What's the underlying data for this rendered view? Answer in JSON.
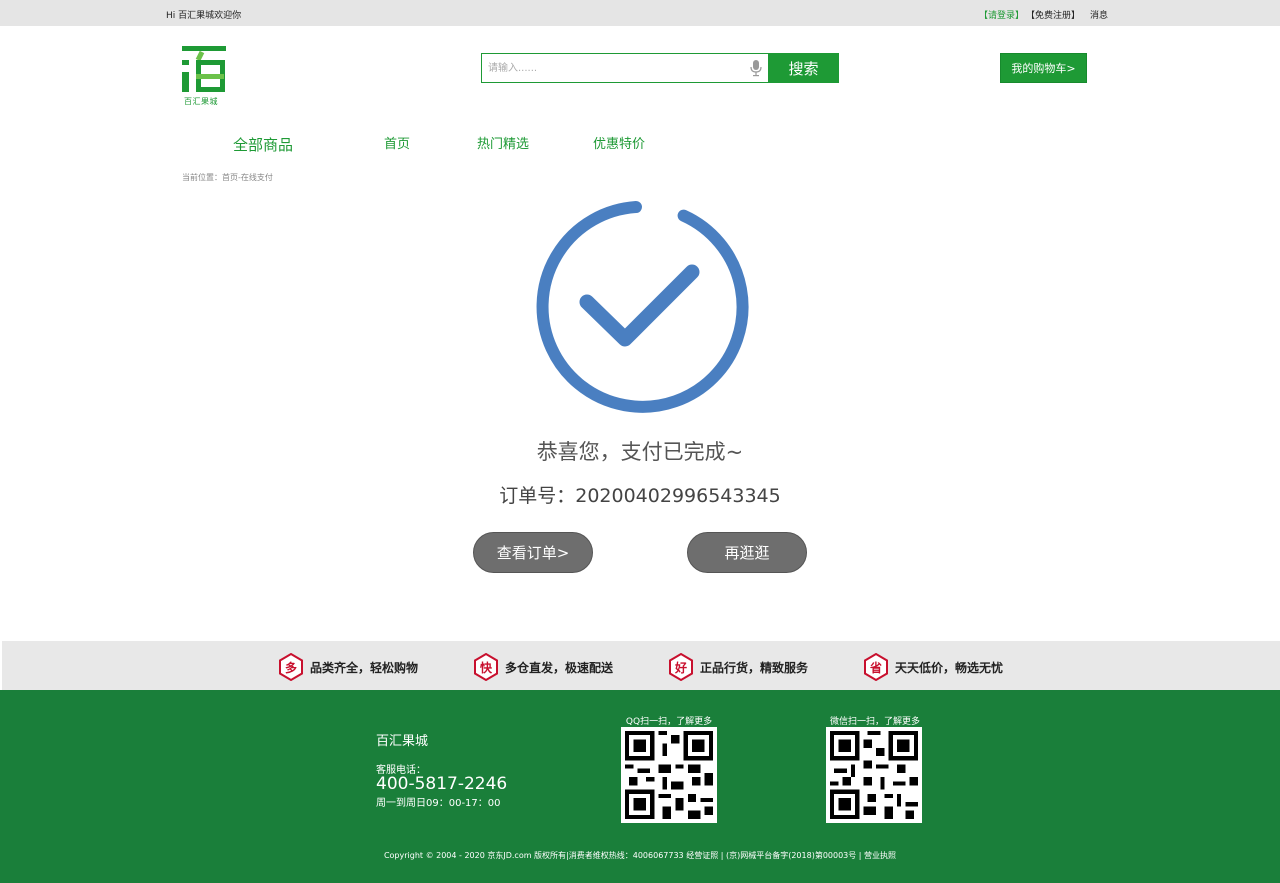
{
  "topbar": {
    "greeting": "Hi 百汇果城欢迎你",
    "login": "【请登录】",
    "register": "【免费注册】",
    "messages": "消息"
  },
  "logo": {
    "text": "百汇果城"
  },
  "search": {
    "placeholder": "请输入......",
    "button": "搜索"
  },
  "cart": {
    "label": "我的购物车>"
  },
  "nav": {
    "all": "全部商品",
    "home": "首页",
    "hot": "热门精选",
    "deals": "优惠特价"
  },
  "breadcrumb": "当前位置：首页-在线支付",
  "result": {
    "message": "恭喜您，支付已完成~",
    "order": "订单号：20200402996543345"
  },
  "actions": {
    "view_order": "查看订单>",
    "shop_more": "再逛逛"
  },
  "features": [
    {
      "badge": "多",
      "text": "品类齐全，轻松购物"
    },
    {
      "badge": "快",
      "text": "多仓直发，极速配送"
    },
    {
      "badge": "好",
      "text": "正品行货，精致服务"
    },
    {
      "badge": "省",
      "text": "天天低价，畅选无忧"
    }
  ],
  "footer": {
    "brand": "百汇果城",
    "service_label": "客服电话：",
    "phone": "400-5817-2246",
    "hours": "周一到周日09：00-17：00",
    "qq_label": "QQ扫一扫，了解更多",
    "wechat_label": "微信扫一扫，了解更多",
    "copyright": "Copyright © 2004 - 2020 京东JD.com 版权所有|消费者维权热线：4006067733 经营证照 | (京)网械平台备字(2018)第00003号 | 营业执照"
  },
  "colors": {
    "brand_green": "#1e9a35",
    "footer_green": "#1a7f3a",
    "check_blue": "#4a7fc1",
    "badge_red": "#c8102e"
  }
}
